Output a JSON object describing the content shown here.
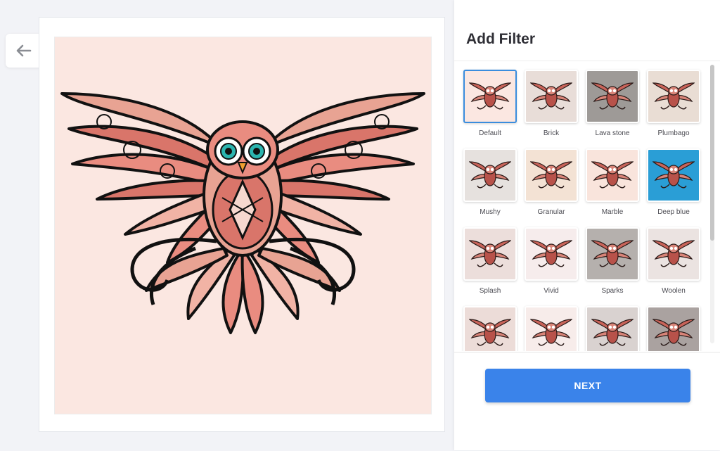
{
  "header": {
    "title": "Add Filter"
  },
  "actions": {
    "next_label": "NEXT"
  },
  "icons": {
    "back": "arrow-left-icon",
    "owl": "owl-mandala-icon"
  },
  "colors": {
    "accent": "#3a83ea",
    "selected_border": "#3a8dde",
    "canvas_bg": "#fbe7e1"
  },
  "filters": [
    {
      "label": "Default",
      "bg": "#fbe7e1",
      "selected": true
    },
    {
      "label": "Brick",
      "bg": "#e8ddd8"
    },
    {
      "label": "Lava stone",
      "bg": "#9e9a97"
    },
    {
      "label": "Plumbago",
      "bg": "#e9ddd4"
    },
    {
      "label": "Mushy",
      "bg": "#e6e1de"
    },
    {
      "label": "Granular",
      "bg": "#f3e2d4"
    },
    {
      "label": "Marble",
      "bg": "#f9e4dc"
    },
    {
      "label": "Deep blue",
      "bg": "#2a9ed6"
    },
    {
      "label": "Splash",
      "bg": "#ecdedb"
    },
    {
      "label": "Vivid",
      "bg": "#f6ecec"
    },
    {
      "label": "Sparks",
      "bg": "#b5b0ad"
    },
    {
      "label": "Woolen",
      "bg": "#ebe3e1"
    },
    {
      "label": "",
      "bg": "#ecdcd8"
    },
    {
      "label": "",
      "bg": "#f7ecea"
    },
    {
      "label": "",
      "bg": "#d9d2d0"
    },
    {
      "label": "",
      "bg": "#aaa2a0"
    }
  ]
}
